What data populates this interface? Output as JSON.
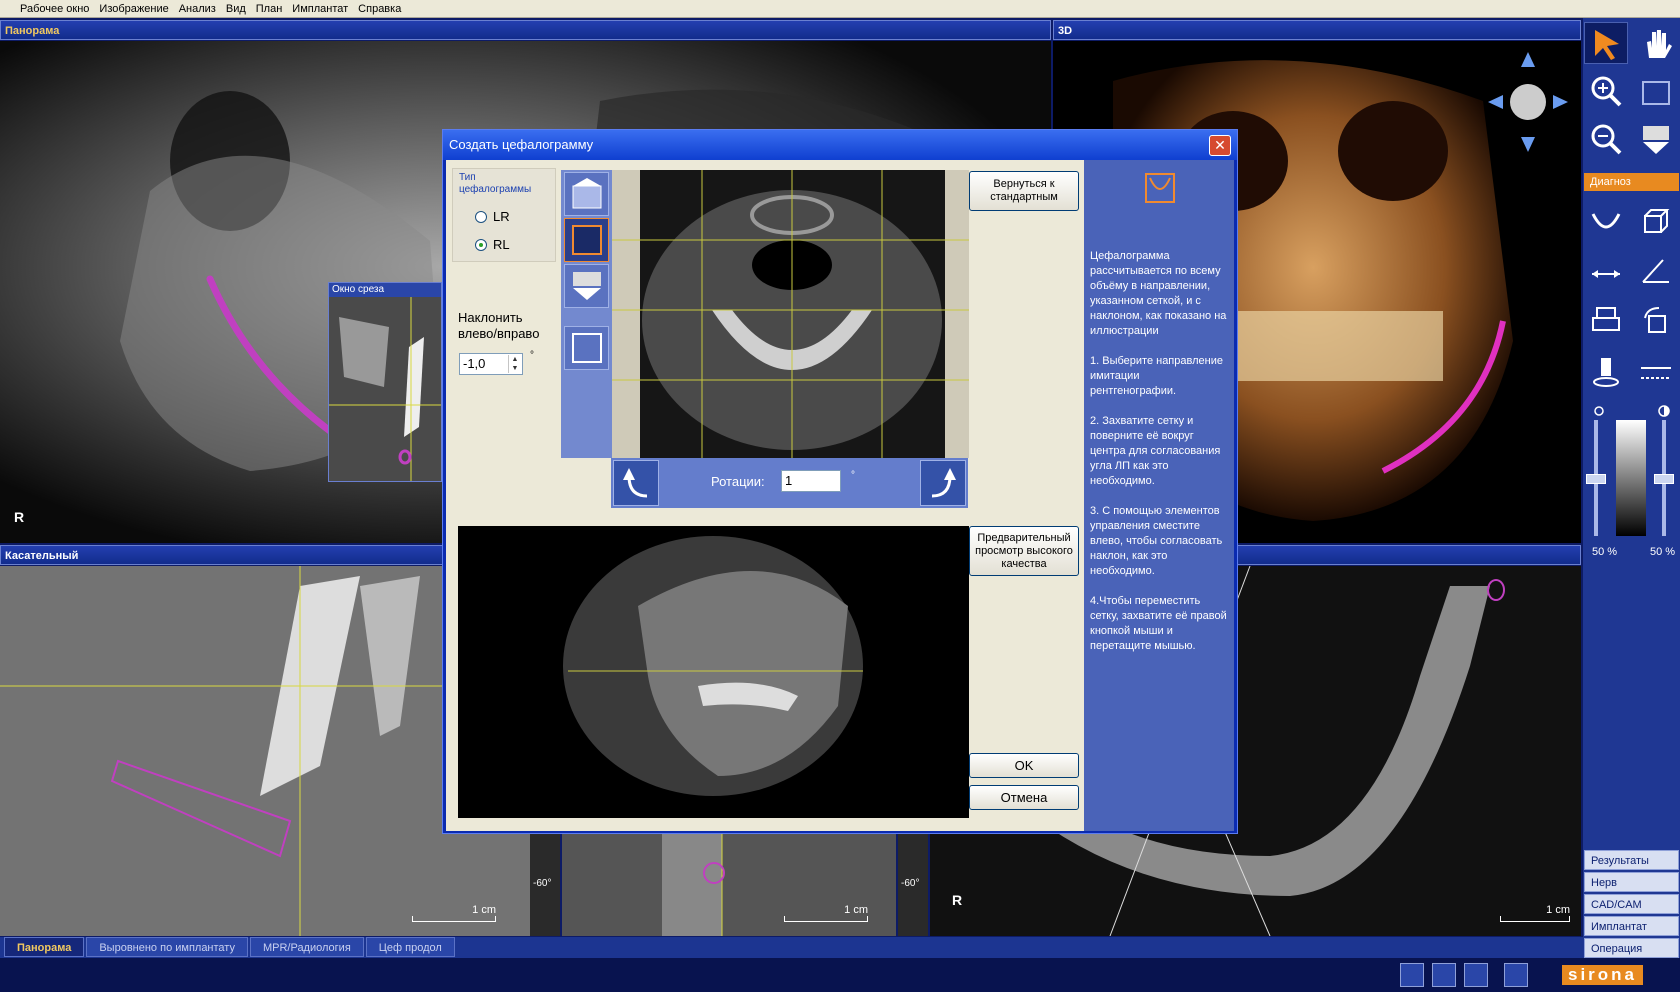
{
  "menu": [
    "Рабочее окно",
    "Изображение",
    "Анализ",
    "Вид",
    "План",
    "Имплантат",
    "Справка"
  ],
  "panels": {
    "panorama": {
      "title": "Панорама",
      "orient": "R",
      "inset_label": "Окно среза"
    },
    "view3d": {
      "title": "3D"
    },
    "tangential": {
      "title": "Касательный",
      "scale": "1 cm"
    },
    "cross": {
      "angle": "-60°",
      "scale": "1 cm"
    },
    "cross2": {
      "angle": "-60°"
    },
    "axial": {
      "orient": "R",
      "scale": "1 cm"
    }
  },
  "sidebar": {
    "diagnosis_label": "Диагноз",
    "brightness_value": "50 %",
    "contrast_value": "50 %",
    "buttons": [
      "Результаты",
      "Нерв",
      "CAD/CAM",
      "Имплантат",
      "Операция"
    ]
  },
  "tabs": [
    "Панорама",
    "Выровнено по имплантату",
    "MPR/Радиология",
    "Цеф продол"
  ],
  "brand": "sirona",
  "dialog": {
    "title": "Создать цефалограмму",
    "close_glyph": "✕",
    "type_group_label": "Тип цефалограммы",
    "radio_lr": "LR",
    "radio_rl": "RL",
    "selected_type": "RL",
    "tilt_label": "Наклонить влево/вправо",
    "tilt_value": "-1,0",
    "degree_symbol": "°",
    "rotation_label": "Ротации:",
    "rotation_value": "1",
    "reset_button": "Вернуться к стандартным",
    "preview_button": "Предварительный просмотр высокого качества",
    "ok_button": "OK",
    "cancel_button": "Отмена",
    "help_paragraphs": [
      "Цефалограмма рассчитывается по всему объёму в направлении, указанном сеткой, и с наклоном, как показано на иллюстрации",
      "1. Выберите направление имитации рентгенографии.",
      "2. Захватите сетку и поверните её вокруг центра для согласования угла ЛП как это необходимо.",
      "3. С помощью элементов управления сместите влево, чтобы согласовать наклон, как это необходимо.",
      "4.Чтобы переместить сетку, захватите её правой кнопкой мыши и перетащите мышью."
    ]
  },
  "colors": {
    "accent_orange": "#e88a20",
    "title_gold": "#f0c860",
    "panel_blue": "#1f3793",
    "nerve_magenta": "#c040c0"
  }
}
